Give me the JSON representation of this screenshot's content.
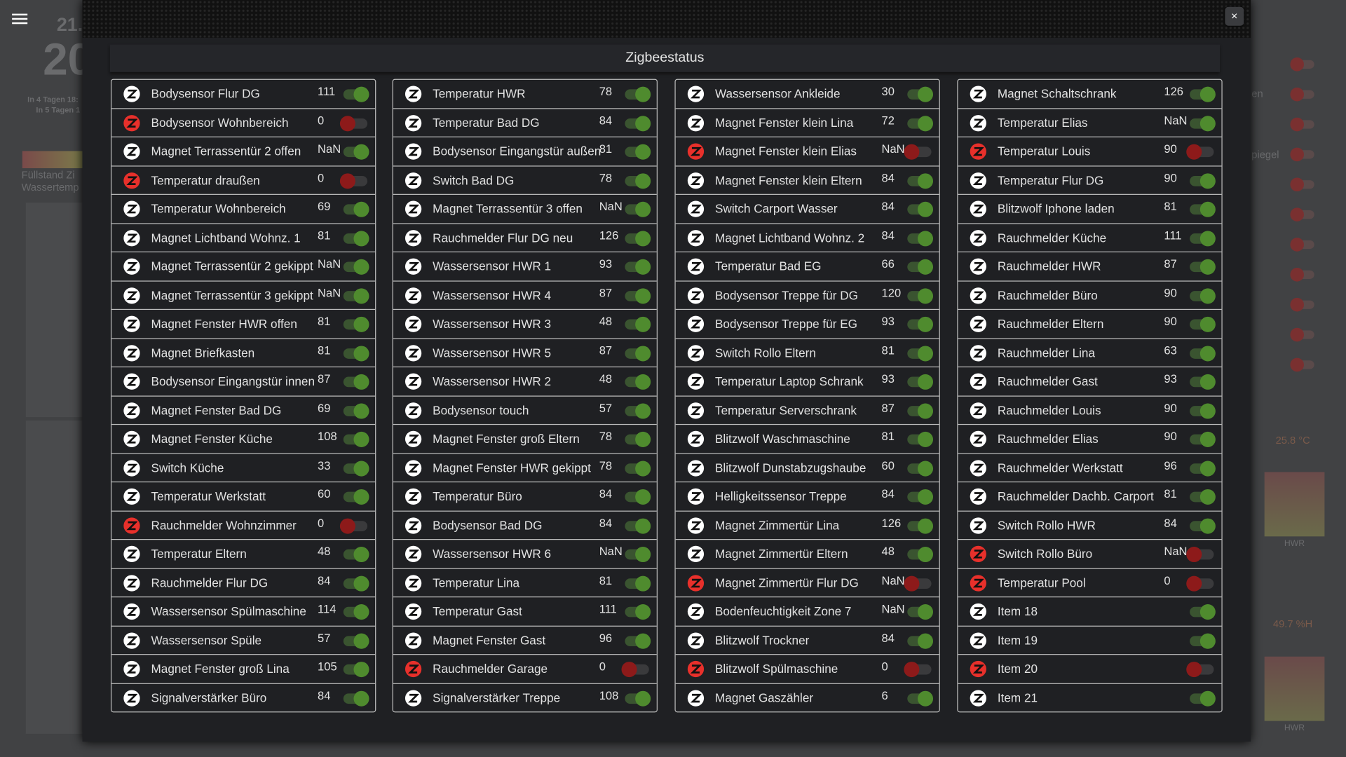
{
  "background": {
    "date_small": "21.",
    "date_big": "20",
    "line1": "In 4 Tagen 18:",
    "line2": "In 5 Tagen 1",
    "label1": "Füllstand Zi",
    "label2": "Wassertemp",
    "right_label1": "en",
    "right_label2": "piegel",
    "temp": "25.8 °C",
    "hum": "49.7 %H",
    "hwr1": "HWR",
    "hwr2": "HWR"
  },
  "modal": {
    "title": "Zigbeestatus",
    "close_label": "×"
  },
  "colors": {
    "on": "#4f8b2e",
    "off": "#8d1a1a",
    "icon_off": "#e8302b"
  },
  "columns": [
    [
      [
        "Bodysensor Flur DG",
        "111",
        true
      ],
      [
        "Bodysensor Wohnbereich",
        "0",
        false
      ],
      [
        "Magnet Terrassentür 2 offen",
        "NaN",
        true
      ],
      [
        "Temperatur draußen",
        "0",
        false
      ],
      [
        "Temperatur Wohnbereich",
        "69",
        true
      ],
      [
        "Magnet Lichtband Wohnz. 1",
        "81",
        true
      ],
      [
        "Magnet Terrassentür 2 gekippt",
        "NaN",
        true
      ],
      [
        "Magnet Terrassentür 3 gekippt",
        "NaN",
        true
      ],
      [
        "Magnet Fenster HWR offen",
        "81",
        true
      ],
      [
        "Magnet Briefkasten",
        "81",
        true
      ],
      [
        "Bodysensor Eingangstür innen",
        "87",
        true
      ],
      [
        "Magnet Fenster Bad DG",
        "69",
        true
      ],
      [
        "Magnet Fenster Küche",
        "108",
        true
      ],
      [
        "Switch Küche",
        "33",
        true
      ],
      [
        "Temperatur Werkstatt",
        "60",
        true
      ],
      [
        "Rauchmelder Wohnzimmer",
        "0",
        false
      ],
      [
        "Temperatur Eltern",
        "48",
        true
      ],
      [
        "Rauchmelder Flur DG",
        "84",
        true
      ],
      [
        "Wassersensor Spülmaschine",
        "114",
        true
      ],
      [
        "Wassersensor Spüle",
        "57",
        true
      ],
      [
        "Magnet Fenster groß Lina",
        "105",
        true
      ],
      [
        "Signalverstärker Büro",
        "84",
        true
      ]
    ],
    [
      [
        "Temperatur HWR",
        "78",
        true
      ],
      [
        "Temperatur Bad DG",
        "84",
        true
      ],
      [
        "Bodysensor Eingangstür außen",
        "81",
        true
      ],
      [
        "Switch Bad DG",
        "78",
        true
      ],
      [
        "Magnet Terrassentür 3 offen",
        "NaN",
        true
      ],
      [
        "Rauchmelder Flur DG neu",
        "126",
        true
      ],
      [
        "Wassersensor HWR 1",
        "93",
        true
      ],
      [
        "Wassersensor HWR 4",
        "87",
        true
      ],
      [
        "Wassersensor HWR 3",
        "48",
        true
      ],
      [
        "Wassersensor HWR 5",
        "87",
        true
      ],
      [
        "Wassersensor HWR 2",
        "48",
        true
      ],
      [
        "Bodysensor touch",
        "57",
        true
      ],
      [
        "Magnet Fenster groß Eltern",
        "78",
        true
      ],
      [
        "Magnet Fenster HWR gekippt",
        "78",
        true
      ],
      [
        "Temperatur Büro",
        "84",
        true
      ],
      [
        "Bodysensor Bad DG",
        "84",
        true
      ],
      [
        "Wassersensor HWR 6",
        "NaN",
        true
      ],
      [
        "Temperatur Lina",
        "81",
        true
      ],
      [
        "Temperatur Gast",
        "111",
        true
      ],
      [
        "Magnet Fenster Gast",
        "96",
        true
      ],
      [
        "Rauchmelder Garage",
        "0",
        false
      ],
      [
        "Signalverstärker Treppe",
        "108",
        true
      ]
    ],
    [
      [
        "Wassersensor Ankleide",
        "30",
        true
      ],
      [
        "Magnet Fenster klein Lina",
        "72",
        true
      ],
      [
        "Magnet Fenster klein Elias",
        "NaN",
        false
      ],
      [
        "Magnet Fenster klein Eltern",
        "84",
        true
      ],
      [
        "Switch Carport Wasser",
        "84",
        true
      ],
      [
        "Magnet Lichtband Wohnz. 2",
        "84",
        true
      ],
      [
        "Temperatur Bad EG",
        "66",
        true
      ],
      [
        "Bodysensor Treppe für DG",
        "120",
        true
      ],
      [
        "Bodysensor Treppe für EG",
        "93",
        true
      ],
      [
        "Switch Rollo Eltern",
        "81",
        true
      ],
      [
        "Temperatur Laptop Schrank",
        "93",
        true
      ],
      [
        "Temperatur Serverschrank",
        "87",
        true
      ],
      [
        "Blitzwolf Waschmaschine",
        "81",
        true
      ],
      [
        "Blitzwolf Dunstabzugshaube",
        "60",
        true
      ],
      [
        "Helligkeitssensor Treppe",
        "84",
        true
      ],
      [
        "Magnet Zimmertür Lina",
        "126",
        true
      ],
      [
        "Magnet Zimmertür Eltern",
        "48",
        true
      ],
      [
        "Magnet Zimmertür Flur DG",
        "NaN",
        false
      ],
      [
        "Bodenfeuchtigkeit Zone 7",
        "NaN",
        true
      ],
      [
        "Blitzwolf Trockner",
        "84",
        true
      ],
      [
        "Blitzwolf Spülmaschine",
        "0",
        false
      ],
      [
        "Magnet Gaszähler",
        "6",
        true
      ]
    ],
    [
      [
        "Magnet Schaltschrank",
        "126",
        true
      ],
      [
        "Temperatur Elias",
        "NaN",
        true
      ],
      [
        "Temperatur Louis",
        "90",
        false
      ],
      [
        "Temperatur Flur DG",
        "90",
        true
      ],
      [
        "Blitzwolf Iphone laden",
        "81",
        true
      ],
      [
        "Rauchmelder Küche",
        "111",
        true
      ],
      [
        "Rauchmelder HWR",
        "87",
        true
      ],
      [
        "Rauchmelder Büro",
        "90",
        true
      ],
      [
        "Rauchmelder Eltern",
        "90",
        true
      ],
      [
        "Rauchmelder Lina",
        "63",
        true
      ],
      [
        "Rauchmelder Gast",
        "93",
        true
      ],
      [
        "Rauchmelder Louis",
        "90",
        true
      ],
      [
        "Rauchmelder Elias",
        "90",
        true
      ],
      [
        "Rauchmelder Werkstatt",
        "96",
        true
      ],
      [
        "Rauchmelder Dachb. Carport",
        "81",
        true
      ],
      [
        "Switch Rollo HWR",
        "84",
        true
      ],
      [
        "Switch Rollo Büro",
        "NaN",
        false
      ],
      [
        "Temperatur Pool",
        "0",
        false
      ],
      [
        "Item 18",
        "",
        true
      ],
      [
        "Item 19",
        "",
        true
      ],
      [
        "Item 20",
        "",
        false
      ],
      [
        "Item 21",
        "",
        true
      ]
    ]
  ]
}
